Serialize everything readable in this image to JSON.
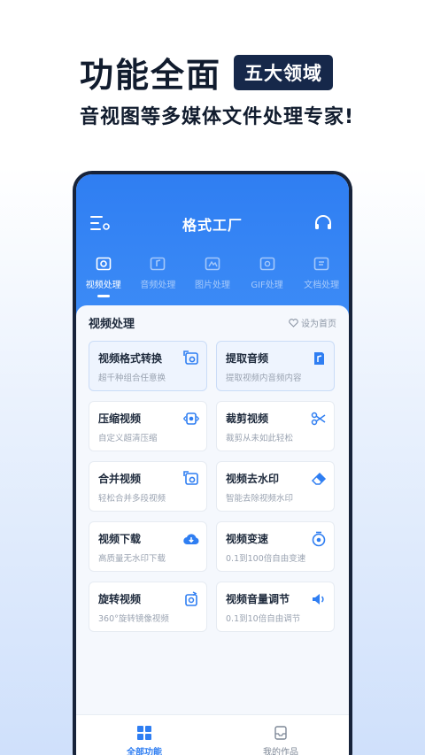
{
  "promo": {
    "headline": "功能全面",
    "badge": "五大领域",
    "subline": "音视图等多媒体文件处理专家!"
  },
  "app": {
    "title": "格式工厂",
    "tabs": [
      {
        "label": "视频处理",
        "icon": "video-icon"
      },
      {
        "label": "音频处理",
        "icon": "audio-icon"
      },
      {
        "label": "图片处理",
        "icon": "image-icon"
      },
      {
        "label": "GIF处理",
        "icon": "gif-icon"
      },
      {
        "label": "文档处理",
        "icon": "document-icon"
      }
    ],
    "section_title": "视频处理",
    "set_home": "设为首页",
    "cards": [
      {
        "title": "视频格式转换",
        "desc": "超千种组合任意换",
        "icon": "video-convert-icon"
      },
      {
        "title": "提取音频",
        "desc": "提取视频内音频内容",
        "icon": "audio-extract-icon"
      },
      {
        "title": "压缩视频",
        "desc": "自定义超清压缩",
        "icon": "compress-icon"
      },
      {
        "title": "裁剪视频",
        "desc": "裁剪从未如此轻松",
        "icon": "scissors-icon"
      },
      {
        "title": "合并视频",
        "desc": "轻松合并多段视频",
        "icon": "merge-icon"
      },
      {
        "title": "视频去水印",
        "desc": "智能去除视频水印",
        "icon": "eraser-icon"
      },
      {
        "title": "视频下载",
        "desc": "高质量无水印下载",
        "icon": "download-icon"
      },
      {
        "title": "视频变速",
        "desc": "0.1到100倍自由变速",
        "icon": "speed-icon"
      },
      {
        "title": "旋转视频",
        "desc": "360°旋转镜像视频",
        "icon": "rotate-icon"
      },
      {
        "title": "视频音量调节",
        "desc": "0.1到10倍自由调节",
        "icon": "volume-icon"
      }
    ],
    "bottom_nav": [
      {
        "label": "全部功能",
        "icon": "grid-icon"
      },
      {
        "label": "我的作品",
        "icon": "inbox-icon"
      }
    ],
    "colors": {
      "accent": "#2f7ef2",
      "dark": "#16284a"
    }
  }
}
